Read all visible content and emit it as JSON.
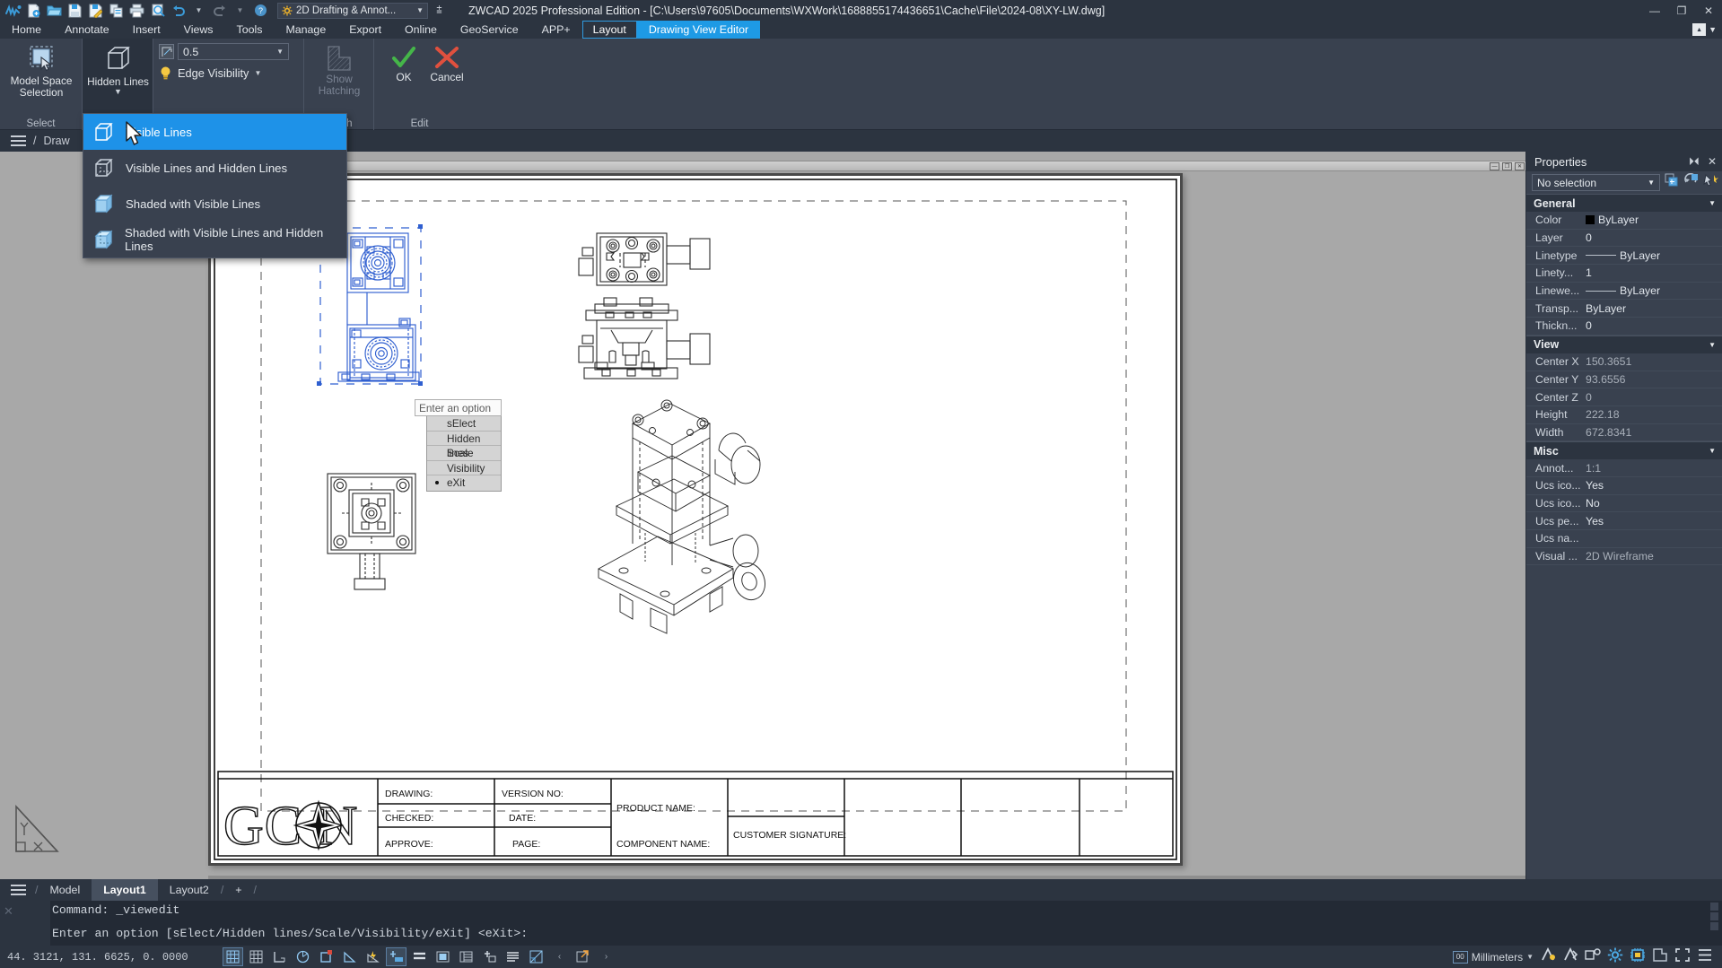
{
  "titlebar": {
    "workspace": "2D Drafting & Annot...",
    "app_title": "ZWCAD 2025 Professional Edition - [C:\\Users\\97605\\Documents\\WXWork\\1688855174436651\\Cache\\File\\2024-08\\XY-LW.dwg]",
    "quick_access_icons": [
      "zwcad-logo-icon",
      "new-file-icon",
      "open-file-icon",
      "save-icon",
      "save-as-icon",
      "copy-icon",
      "print-icon",
      "print-preview-icon",
      "undo-icon",
      "undo-caret-icon",
      "redo-icon",
      "redo-caret-icon",
      "help-icon"
    ],
    "window_buttons": [
      "minimize",
      "maximize",
      "close"
    ]
  },
  "menubar": {
    "items": [
      {
        "label": "Home",
        "state": "normal"
      },
      {
        "label": "Annotate",
        "state": "normal"
      },
      {
        "label": "Insert",
        "state": "normal"
      },
      {
        "label": "Views",
        "state": "normal"
      },
      {
        "label": "Tools",
        "state": "normal"
      },
      {
        "label": "Manage",
        "state": "normal"
      },
      {
        "label": "Export",
        "state": "normal"
      },
      {
        "label": "Online",
        "state": "normal"
      },
      {
        "label": "GeoService",
        "state": "normal"
      },
      {
        "label": "APP+",
        "state": "normal"
      },
      {
        "label": "Layout",
        "state": "boxed"
      },
      {
        "label": "Drawing View Editor",
        "state": "active"
      }
    ]
  },
  "ribbon": {
    "select_panel": {
      "title": "Select",
      "button_label": "Model Space\nSelection",
      "button_line1": "Model Space",
      "button_line2": "Selection"
    },
    "hidden_lines_panel": {
      "button_label": "Hidden Lines"
    },
    "scale_panel": {
      "scale_value": "0.5",
      "edge_visibility_label": "Edge Visibility"
    },
    "hatch_panel": {
      "button_line1": "Show",
      "button_line2": "Hatching",
      "title": "Hatch",
      "disabled": true
    },
    "edit_panel": {
      "title": "Edit",
      "ok_label": "OK",
      "cancel_label": "Cancel"
    }
  },
  "dropdown": {
    "items": [
      {
        "label": "Visible Lines",
        "selected": true,
        "icon": "cube-wire-icon"
      },
      {
        "label": "Visible Lines and Hidden Lines",
        "selected": false,
        "icon": "cube-hidden-icon"
      },
      {
        "label": "Shaded with Visible Lines",
        "selected": false,
        "icon": "cube-shaded-icon"
      },
      {
        "label": "Shaded with Visible Lines and Hidden Lines",
        "selected": false,
        "icon": "cube-shaded-hidden-icon"
      }
    ]
  },
  "breadcrumb": {
    "separator": "/",
    "text": "Draw"
  },
  "option_popup": {
    "prompt": "Enter an option",
    "options": [
      {
        "label": "sElect",
        "current": false
      },
      {
        "label": "Hidden lines",
        "current": false
      },
      {
        "label": "Scale",
        "current": false
      },
      {
        "label": "Visibility",
        "current": false
      },
      {
        "label": "eXit",
        "current": true
      }
    ]
  },
  "drawing": {
    "logo_text": "GCON",
    "title_block": [
      {
        "label": "DRAWING:",
        "value": ""
      },
      {
        "label": "VERSION NO:",
        "value": ""
      },
      {
        "label": "PRODUCT NAME:",
        "value": ""
      },
      {
        "label": "CHECKED:",
        "value": ""
      },
      {
        "label": "DATE:",
        "value": ""
      },
      {
        "label": "CUSTOMER SIGNATURE:",
        "value": ""
      },
      {
        "label": "APPROVE:",
        "value": ""
      },
      {
        "label": "PAGE:",
        "value": ""
      },
      {
        "label": "COMPONENT NAME:",
        "value": ""
      }
    ],
    "labels": {
      "drawing": "DRAWING:",
      "version_no": "VERSION NO:",
      "product_name": "PRODUCT NAME:",
      "checked": "CHECKED:",
      "date": "DATE:",
      "customer_signature": "CUSTOMER SIGNATURE:",
      "approve": "APPROVE:",
      "page": "PAGE:",
      "component_name": "COMPONENT NAME:"
    },
    "window_buttons": [
      "minimize",
      "restore",
      "close"
    ]
  },
  "properties": {
    "header": "Properties",
    "selection": "No selection",
    "groups": [
      {
        "name": "General",
        "rows": [
          {
            "key": "Color",
            "value": "ByLayer",
            "swatch": "#000000"
          },
          {
            "key": "Layer",
            "value": "0"
          },
          {
            "key": "Linetype",
            "value": "ByLayer",
            "line": true
          },
          {
            "key": "Linety...",
            "value": "1"
          },
          {
            "key": "Linewe...",
            "value": "ByLayer",
            "line": true
          },
          {
            "key": "Transp...",
            "value": "ByLayer"
          },
          {
            "key": "Thickn...",
            "value": "0"
          }
        ]
      },
      {
        "name": "View",
        "rows": [
          {
            "key": "Center X",
            "value": "150.3651"
          },
          {
            "key": "Center Y",
            "value": "93.6556"
          },
          {
            "key": "Center Z",
            "value": "0"
          },
          {
            "key": "Height",
            "value": "222.18"
          },
          {
            "key": "Width",
            "value": "672.8341"
          }
        ]
      },
      {
        "name": "Misc",
        "rows": [
          {
            "key": "Annot...",
            "value": "1:1"
          },
          {
            "key": "Ucs ico...",
            "value": "Yes"
          },
          {
            "key": "Ucs ico...",
            "value": "No"
          },
          {
            "key": "Ucs pe...",
            "value": "Yes"
          },
          {
            "key": "Ucs na...",
            "value": ""
          },
          {
            "key": "Visual ...",
            "value": "2D Wireframe"
          }
        ]
      }
    ]
  },
  "layout_tabs": {
    "items": [
      {
        "label": "Model",
        "active": false
      },
      {
        "label": "Layout1",
        "active": true
      },
      {
        "label": "Layout2",
        "active": false
      },
      {
        "label": "+",
        "active": false
      }
    ]
  },
  "command_line": {
    "line1": "Command: _viewedit",
    "line2": "Enter an option [sElect/Hidden lines/Scale/Visibility/eXit] <eXit>:"
  },
  "status_bar": {
    "coordinates": "44. 3121,  131. 6625,  0. 0000",
    "toggle_icons": [
      {
        "name": "grid-display-icon",
        "on": true
      },
      {
        "name": "snap-mode-icon",
        "on": false
      },
      {
        "name": "ortho-mode-icon",
        "on": false
      },
      {
        "name": "polar-tracking-icon",
        "on": false
      },
      {
        "name": "object-snap-icon",
        "on": false
      },
      {
        "name": "osnap-angle-icon",
        "on": false
      },
      {
        "name": "otrack-icon",
        "on": false
      },
      {
        "name": "dynamic-input-icon",
        "on": true
      },
      {
        "name": "lineweight-icon",
        "on": false
      },
      {
        "name": "transparency-icon",
        "on": false
      },
      {
        "name": "quick-properties-icon",
        "on": false
      },
      {
        "name": "selection-cycling-icon",
        "on": false
      },
      {
        "name": "annotation-visibility-icon",
        "on": false
      },
      {
        "name": "annotation-scale-icon",
        "on": false
      },
      {
        "name": "workspace-switch-icon",
        "on": false
      }
    ],
    "units": "Millimeters",
    "right_icons": [
      "annotation-scale-icon",
      "model-layout-icon",
      "clean-screen-icon",
      "settings-gear-icon",
      "hardware-accel-icon",
      "isolate-objects-icon",
      "fullscreen-icon",
      "customization-menu-icon"
    ]
  }
}
